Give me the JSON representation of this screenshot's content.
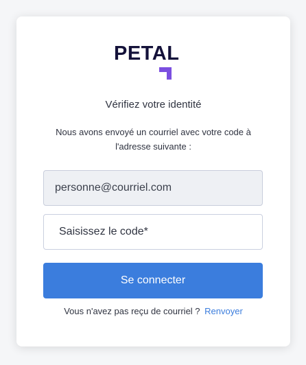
{
  "brand": {
    "name": "PETAL",
    "color": "#14123a",
    "accent": "#7b4fe0"
  },
  "heading": "Vérifiez votre identité",
  "description_line1": "Nous avons envoyé un courriel avec votre code à",
  "description_line2": "l'adresse suivante :",
  "email_field": {
    "value": "personne@courriel.com"
  },
  "code_field": {
    "placeholder": "Saisissez le code*"
  },
  "submit_label": "Se connecter",
  "resend": {
    "prompt": "Vous n'avez pas reçu de courriel ?",
    "link": "Renvoyer"
  },
  "colors": {
    "primary": "#3b7ddd",
    "text": "#2f3340",
    "background": "#f5f6f8"
  }
}
